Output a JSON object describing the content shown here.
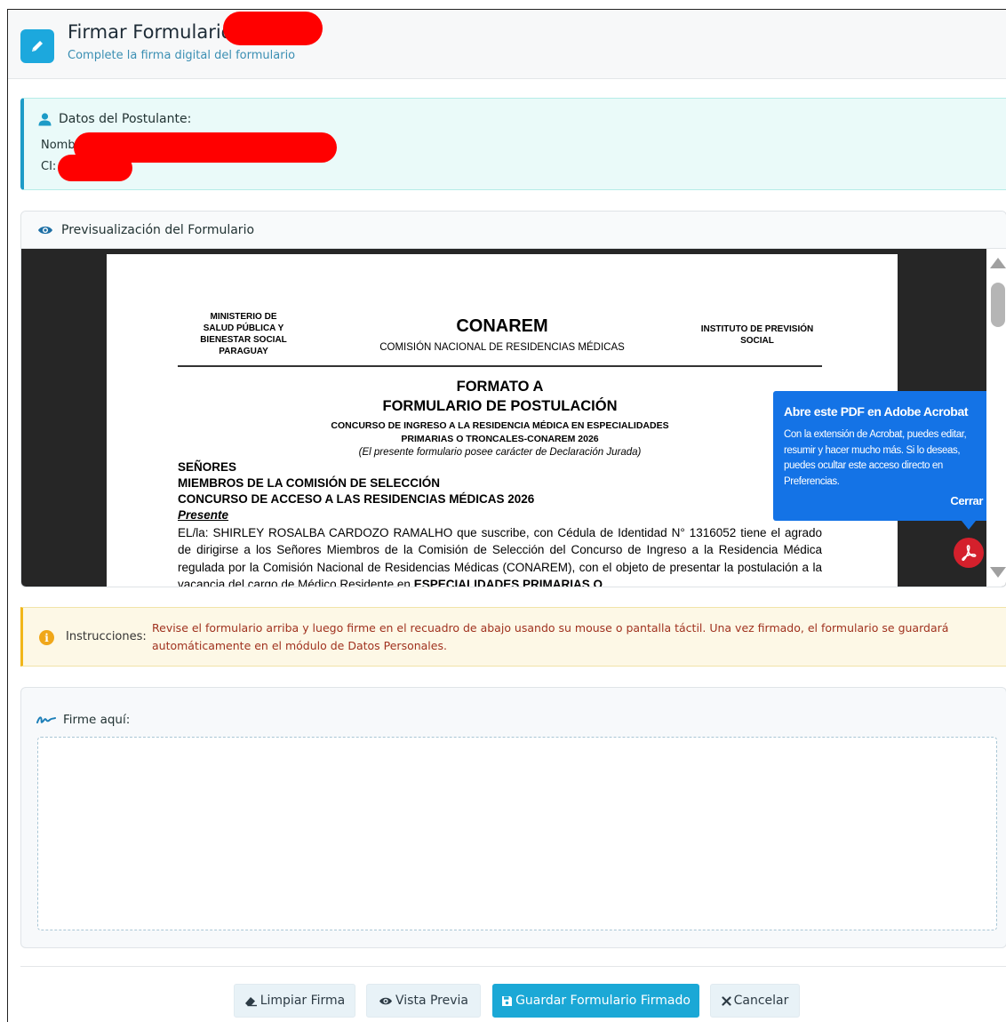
{
  "header": {
    "title": "Firmar Formulario a",
    "subtitle": "Complete la firma digital del formulario",
    "icon": "pen-icon",
    "accent": "#1ca8dd"
  },
  "applicant": {
    "title": "Datos del Postulante:",
    "name_label": "Nomb",
    "ci_label": "CI:"
  },
  "preview": {
    "title": "Previsualización del Formulario",
    "document": {
      "header_left": [
        "MINISTERIO DE",
        "SALUD PÚBLICA Y",
        "BIENESTAR SOCIAL",
        "PARAGUAY"
      ],
      "org": "CONAREM",
      "org_full": "COMISIÓN NACIONAL DE RESIDENCIAS MÉDICAS",
      "header_right": [
        "INSTITUTO DE PREVISIÓN",
        "SOCIAL"
      ],
      "formato": "FORMATO A",
      "form_title": "FORMULARIO DE POSTULACIÓN",
      "concurso": [
        "CONCURSO DE INGRESO A LA RESIDENCIA MÉDICA EN ESPECIALIDADES",
        "PRIMARIAS O TRONCALES-CONAREM 2026"
      ],
      "declaration": "(El presente formulario posee carácter de Declaración Jurada)",
      "senores": "SEÑORES",
      "miembros": "MIEMBROS DE LA COMISIÓN DE SELECCIÓN",
      "concurso_acceso": "CONCURSO DE ACCESO A LAS RESIDENCIAS MÉDICAS 2026",
      "presente": "Presente",
      "body": "EL/la: SHIRLEY ROSALBA CARDOZO RAMALHO que suscribe, con Cédula de Identidad N° 1316052 tiene el agrado de dirigirse a los Señores Miembros de la Comisión de Selección del Concurso de Ingreso a la Residencia Médica regulada por la Comisión Nacional de Residencias Médicas (CONAREM), con el objeto de presentar la postulación a la vacancia del cargo de Médico Residente en",
      "body_bold": "ESPECIALIDADES PRIMARIAS O"
    },
    "acrobat_popup": {
      "title": "Abre este PDF en Adobe Acrobat",
      "body": "Con la extensión de Acrobat, puedes editar, resumir y hacer mucho más. Si lo deseas, puedes ocultar este acceso directo en Preferencias.",
      "close": "Cerrar",
      "color": "#1473e6"
    }
  },
  "instructions": {
    "label": "Instrucciones:",
    "text": "Revise el formulario arriba y luego firme en el recuadro de abajo usando su mouse o pantalla táctil. Una vez firmado, el formulario se guardará automáticamente en el módulo de Datos Personales."
  },
  "signature": {
    "label": "Firme aquí:"
  },
  "buttons": {
    "clear": "Limpiar Firma",
    "preview": "Vista Previa",
    "save": "Guardar Formulario Firmado",
    "cancel": "Cancelar"
  }
}
